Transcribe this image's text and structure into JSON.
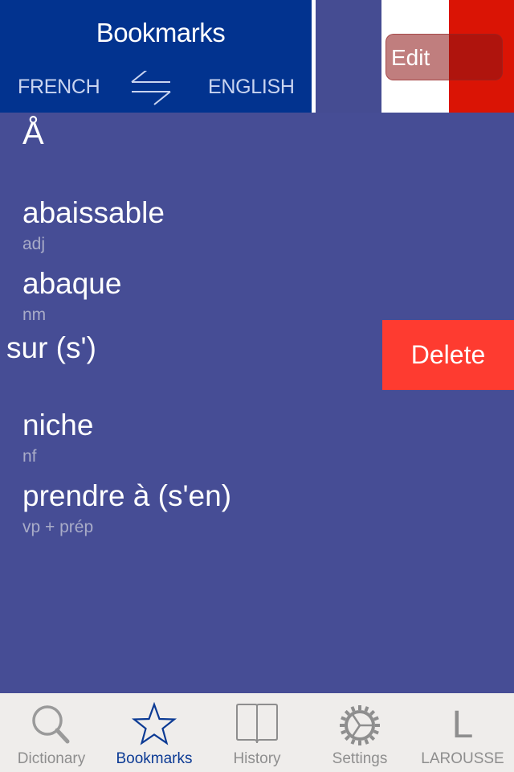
{
  "header": {
    "title": "Bookmarks",
    "source_language": "FRENCH",
    "target_language": "ENGLISH",
    "swap_icon": "swap-arrows-icon",
    "edit_label": "Edit"
  },
  "colors": {
    "header_panel": "#02338f",
    "list_background": "#464d95",
    "flag_blue": "#454c92",
    "flag_white": "#ffffff",
    "flag_red": "#da1405",
    "delete": "#fe3b30",
    "tab_active": "#0b3a94",
    "tab_inactive": "#8e8e8e"
  },
  "list": {
    "section_header": "Å",
    "entries": [
      {
        "word": "abaissable",
        "pos": "adj"
      },
      {
        "word": "abaque",
        "pos": "nm"
      },
      {
        "word": "sur (s')",
        "pos": ""
      },
      {
        "word": "niche",
        "pos": "nf"
      },
      {
        "word": "prendre à (s'en)",
        "pos": "vp + prép"
      }
    ],
    "delete_label": "Delete"
  },
  "tabbar": {
    "active": "Bookmarks",
    "tabs": [
      {
        "label": "Dictionary",
        "icon": "search-icon"
      },
      {
        "label": "Bookmarks",
        "icon": "star-icon"
      },
      {
        "label": "History",
        "icon": "book-icon"
      },
      {
        "label": "Settings",
        "icon": "gear-icon"
      },
      {
        "label": "LAROUSSE",
        "icon": "larousse-logo-icon",
        "glyph": "L"
      }
    ]
  }
}
